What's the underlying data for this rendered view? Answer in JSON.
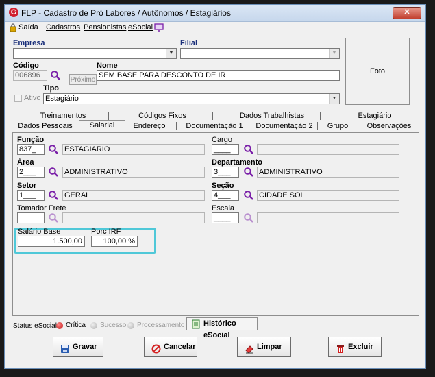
{
  "window": {
    "title": "FLP - Cadastro de Pró Labores / Autônomos / Estagiários",
    "close_glyph": "✕"
  },
  "menu": {
    "saida": "Saída",
    "cadastros": "Cadastros",
    "pensionistas": "Pensionistas",
    "esocial": "eSocial"
  },
  "header": {
    "empresa_label": "Empresa",
    "empresa_value": "",
    "filial_label": "Filial",
    "filial_value": "",
    "codigo_label": "Código",
    "codigo_value": "006896",
    "proximo_label": "Próximo",
    "nome_label": "Nome",
    "nome_value": "SEM BASE PARA DESCONTO DE IR",
    "ativo_label": "Ativo",
    "tipo_label": "Tipo",
    "tipo_value": "Estagiário",
    "foto_label": "Foto"
  },
  "tabs_row1": [
    "Treinamentos",
    "Códigos Fixos",
    "Dados Trabalhistas",
    "Estagiário"
  ],
  "tabs_row2": [
    "Dados Pessoais",
    "Salarial",
    "Endereço",
    "Documentação 1",
    "Documentação 2",
    "Grupo",
    "Observações"
  ],
  "active_tab": "Salarial",
  "fields": {
    "funcao_label": "Função",
    "funcao_code": "837_",
    "funcao_desc": "ESTAGIARIO",
    "cargo_label": "Cargo",
    "cargo_code": "____",
    "cargo_desc": "",
    "area_label": "Área",
    "area_code": "2___",
    "area_desc": "ADMINISTRATIVO",
    "departamento_label": "Departamento",
    "departamento_code": "3___",
    "departamento_desc": "ADMINISTRATIVO",
    "setor_label": "Setor",
    "setor_code": "1___",
    "setor_desc": "GERAL",
    "secao_label": "Seção",
    "secao_code": "4___",
    "secao_desc": "CIDADE SOL",
    "tomador_label": "Tomador Frete",
    "tomador_code": "",
    "tomador_desc": "",
    "escala_label": "Escala",
    "escala_code": "____",
    "escala_desc": ""
  },
  "salary": {
    "salario_base_label": "Salário Base",
    "salario_base_value": "1.500,00",
    "porc_irf_label": "Porc IRF",
    "porc_irf_value": "100,00 %"
  },
  "status": {
    "label": "Status eSocial:",
    "critica": "Crítica",
    "sucesso": "Sucesso",
    "processamento": "Processamento",
    "historico": "Histórico eSocial"
  },
  "actions": {
    "gravar": "Gravar",
    "cancelar": "Cancelar",
    "limpar": "Limpar",
    "excluir": "Excluir"
  },
  "colors": {
    "accent_purple": "#7a1fa8",
    "highlight": "#4fc8d8",
    "critica_red": "#d42020"
  }
}
